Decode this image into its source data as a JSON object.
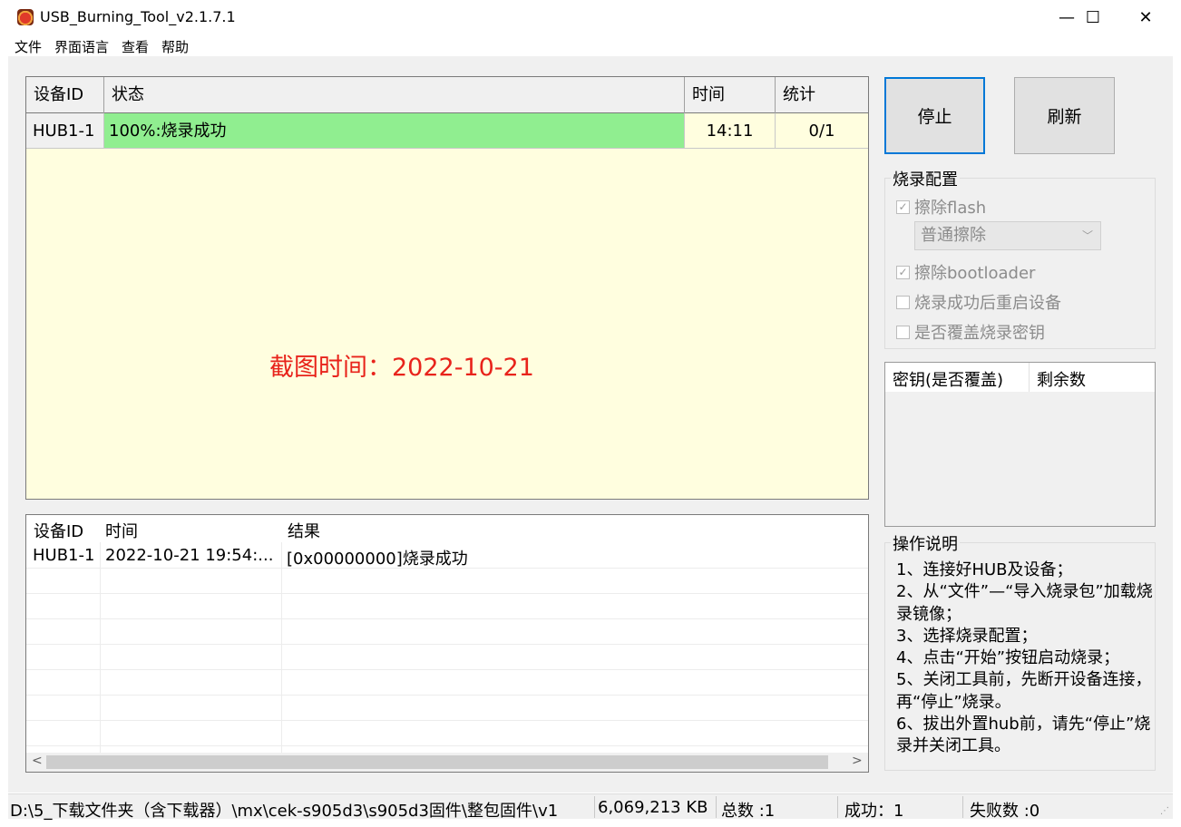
{
  "window": {
    "title": "USB_Burning_Tool_v2.1.7.1",
    "minimize_glyph": "—",
    "maximize_glyph": "☐",
    "close_glyph": "✕"
  },
  "menu": [
    "文件",
    "界面语言",
    "查看",
    "帮助"
  ],
  "device_table": {
    "headers": [
      "设备ID",
      "状态",
      "时间",
      "统计"
    ],
    "rows": [
      {
        "device_id": "HUB1-1",
        "status": "100%:烧录成功",
        "time": "14:11",
        "stats": "0/1"
      }
    ],
    "success_color": "#90ee90",
    "background_color": "#fffedf"
  },
  "watermark": "截图时间：2022-10-21",
  "log_table": {
    "headers": [
      "设备ID",
      "时间",
      "结果"
    ],
    "rows": [
      {
        "device_id": "HUB1-1",
        "time": "2022-10-21 19:54:...",
        "result": "[0x00000000]烧录成功"
      }
    ]
  },
  "buttons": {
    "stop": "停止",
    "refresh": "刷新"
  },
  "burn_config": {
    "title": "烧录配置",
    "erase_flash": {
      "label": "擦除flash",
      "checked": true
    },
    "erase_mode": "普通擦除",
    "erase_bootloader": {
      "label": "擦除bootloader",
      "checked": true
    },
    "reboot_after": {
      "label": "烧录成功后重启设备",
      "checked": false
    },
    "overwrite_key": {
      "label": "是否覆盖烧录密钥",
      "checked": false
    }
  },
  "key_list": {
    "headers": [
      "密钥(是否覆盖)",
      "剩余数"
    ]
  },
  "instructions": {
    "title": "操作说明",
    "lines": [
      "1、连接好HUB及设备；",
      "2、从“文件”—“导入烧录包”加载烧录镜像；",
      "3、选择烧录配置；",
      "4、点击“开始”按钮启动烧录；",
      "5、关闭工具前，先断开设备连接，再“停止”烧录。",
      "6、拔出外置hub前，请先“停止”烧录并关闭工具。"
    ]
  },
  "status_bar": {
    "path": "D:\\5_下载文件夹（含下载器）\\mx\\cek-s905d3\\s905d3固件\\整包固件\\v1",
    "size": "6,069,213 KB",
    "total": "总数 :1",
    "success": "成功：1",
    "failed": "失败数 :0"
  }
}
